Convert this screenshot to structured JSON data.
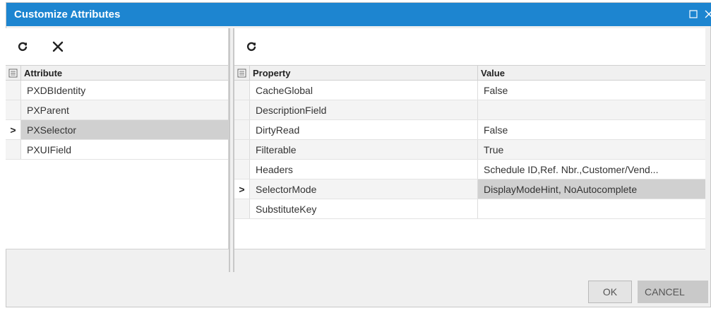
{
  "dialog": {
    "title": "Customize Attributes"
  },
  "left_panel": {
    "toolbar": {
      "refresh_icon": "refresh-icon",
      "delete_icon": "close-icon"
    },
    "header": {
      "attribute": "Attribute"
    },
    "rows": [
      {
        "label": "PXDBIdentity",
        "selected": false
      },
      {
        "label": "PXParent",
        "selected": false
      },
      {
        "label": "PXSelector",
        "selected": true
      },
      {
        "label": "PXUIField",
        "selected": false
      }
    ],
    "selected_marker": ">"
  },
  "right_panel": {
    "toolbar": {
      "refresh_icon": "refresh-icon"
    },
    "header": {
      "property": "Property",
      "value": "Value"
    },
    "rows": [
      {
        "property": "CacheGlobal",
        "value": "False"
      },
      {
        "property": "DescriptionField",
        "value": ""
      },
      {
        "property": "DirtyRead",
        "value": "False"
      },
      {
        "property": "Filterable",
        "value": "True"
      },
      {
        "property": "Headers",
        "value": "Schedule ID,Ref. Nbr.,Customer/Vend..."
      },
      {
        "property": "SelectorMode",
        "value": "DisplayModeHint, NoAutocomplete"
      },
      {
        "property": "SubstituteKey",
        "value": ""
      }
    ],
    "selected_marker": ">"
  },
  "buttons": {
    "ok": "OK",
    "cancel": "CANCEL"
  },
  "colors": {
    "titlebar": "#1d85d0",
    "selected_row": "#d0d0d0"
  }
}
